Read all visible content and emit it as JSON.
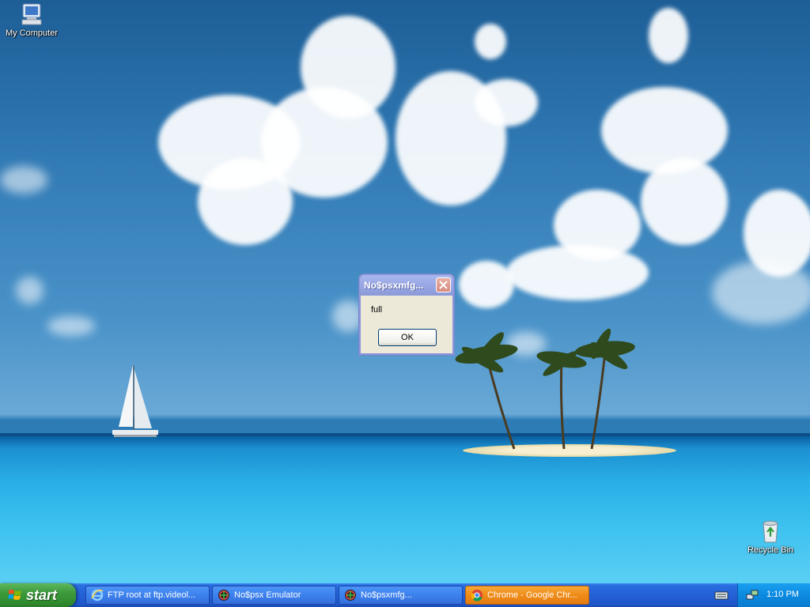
{
  "desktop": {
    "icons": [
      {
        "label": "My Computer",
        "icon": "my-computer-icon"
      },
      {
        "label": "Recycle Bin",
        "icon": "recycle-bin-icon"
      }
    ]
  },
  "dialog": {
    "title": "No$psxmfg...",
    "message": "full",
    "ok_label": "OK"
  },
  "taskbar": {
    "start_label": "start",
    "tasks": [
      {
        "label": "FTP root at ftp.videol...",
        "icon": "internet-explorer-icon",
        "active": false
      },
      {
        "label": "No$psx Emulator",
        "icon": "nocash-psx-icon",
        "active": false
      },
      {
        "label": "No$psxmfg...",
        "icon": "nocash-psx-icon",
        "active": false
      },
      {
        "label": "Chrome - Google Chr...",
        "icon": "chrome-icon",
        "active": true
      }
    ],
    "clock": "1:10 PM"
  },
  "colors": {
    "taskbar_blue": "#2460d6",
    "start_green": "#3c9a3b",
    "active_task_orange": "#ef8b18",
    "dialog_face": "#ece9d8",
    "dialog_title_inactive": "#9aa8e4"
  }
}
